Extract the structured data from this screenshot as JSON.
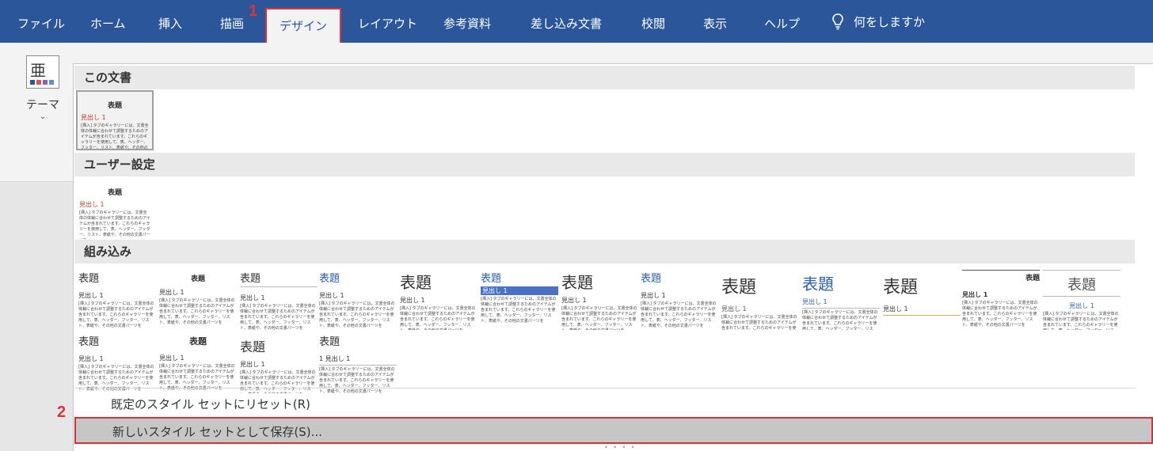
{
  "tabs": [
    {
      "label": "ファイル"
    },
    {
      "label": "ホーム"
    },
    {
      "label": "挿入"
    },
    {
      "label": "描画"
    },
    {
      "label": "デザイン"
    },
    {
      "label": "レイアウト"
    },
    {
      "label": "参考資料"
    },
    {
      "label": "差し込み文書"
    },
    {
      "label": "校閲"
    },
    {
      "label": "表示"
    },
    {
      "label": "ヘルプ"
    }
  ],
  "tell_me": "何をしますか",
  "theme": {
    "label": "テーマ",
    "caret": "⌄",
    "icon_char": "亜"
  },
  "sections": {
    "this_doc": "この文書",
    "custom": "ユーザー設定",
    "builtin": "組み込み"
  },
  "thumb_text": {
    "title": "表題",
    "heading": "見出し 1",
    "heading_numbered": "1 見出し 1",
    "body": "[挿入] タブのギャラリーには、文書全体の体裁に合わせて調整するためのアイテムが含まれています。これらのギャラリーを使用して、表、ヘッダー、フッター、リスト、表紙や、その他の文書パーツを"
  },
  "menu": {
    "reset": "既定のスタイル セットにリセット(R)",
    "save": "新しいスタイル セットとして保存(S)..."
  },
  "steps": {
    "one": "1",
    "two": "2"
  },
  "colors": {
    "ribbon": "#2b579a",
    "highlight_border": "#e3313c"
  }
}
